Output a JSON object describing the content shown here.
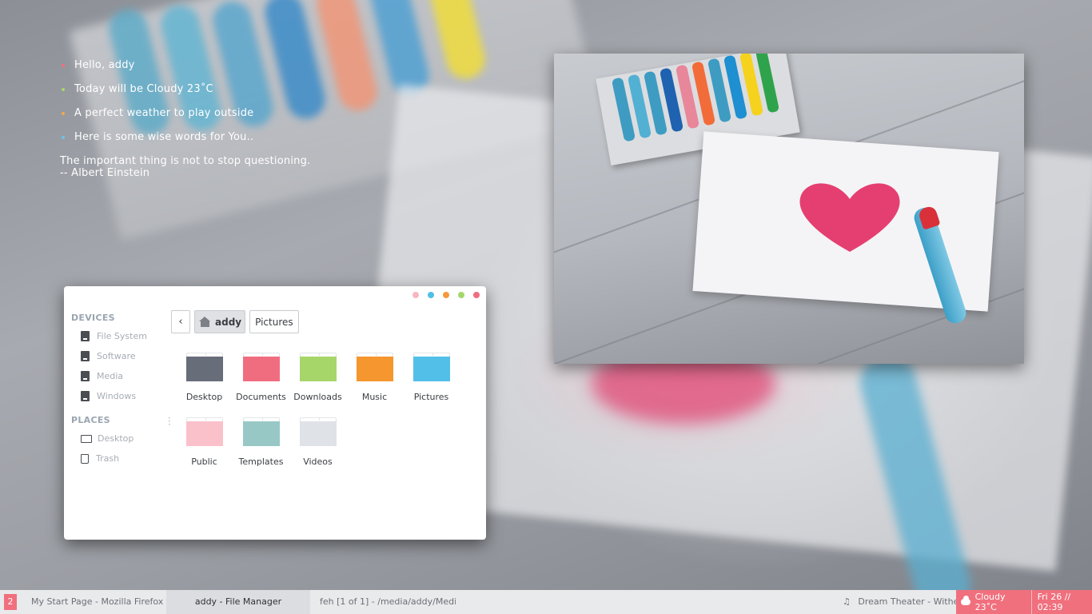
{
  "greeting": {
    "lines": [
      {
        "text": "Hello, addy",
        "dot_color": "#f0707e"
      },
      {
        "text": "Today will be Cloudy 23˚C",
        "dot_color": "#a6d66a"
      },
      {
        "text": "A perfect weather to play outside",
        "dot_color": "#f5a84a"
      },
      {
        "text": "Here is some wise words for You..",
        "dot_color": "#6ec3ea"
      }
    ],
    "quote": "The important thing is not to stop questioning.",
    "author": "-- Albert Einstein"
  },
  "file_manager": {
    "window_button_colors": [
      "#f7b6c2",
      "#4fc0e8",
      "#f59a3c",
      "#a6d66a",
      "#f06d80"
    ],
    "sidebar": {
      "devices_heading": "DEVICES",
      "devices": [
        {
          "label": "File System",
          "icon": "drive-icon"
        },
        {
          "label": "Software",
          "icon": "drive-icon"
        },
        {
          "label": "Media",
          "icon": "drive-icon"
        },
        {
          "label": "Windows",
          "icon": "drive-icon"
        }
      ],
      "places_heading": "PLACES",
      "places": [
        {
          "label": "Desktop",
          "icon": "monitor-icon"
        },
        {
          "label": "Trash",
          "icon": "trash-icon"
        }
      ]
    },
    "pathbar": {
      "back": "‹",
      "home": "addy",
      "current": "Pictures"
    },
    "folders": [
      {
        "label": "Desktop",
        "color": "#676d79"
      },
      {
        "label": "Documents",
        "color": "#f06d80"
      },
      {
        "label": "Downloads",
        "color": "#a6d66a"
      },
      {
        "label": "Music",
        "color": "#f5962f"
      },
      {
        "label": "Pictures",
        "color": "#52bfe8"
      },
      {
        "label": "Public",
        "color": "#fbc1cb"
      },
      {
        "label": "Templates",
        "color": "#98c8c6"
      },
      {
        "label": "Videos",
        "color": "#dfe2e7"
      }
    ]
  },
  "taskbar": {
    "workspace": "2",
    "tasks": [
      {
        "label": "My Start Page - Mozilla Firefox",
        "active": false
      },
      {
        "label": "addy - File Manager",
        "active": true
      },
      {
        "label": "feh [1 of 1] - /media/addy/Medi...",
        "active": false
      }
    ],
    "now_playing_icon": "♫",
    "now_playing": "Dream Theater - Wither",
    "weather": "Cloudy 23˚C",
    "datetime": "Fri 26 // 02:39",
    "accent": "#f0707e"
  }
}
